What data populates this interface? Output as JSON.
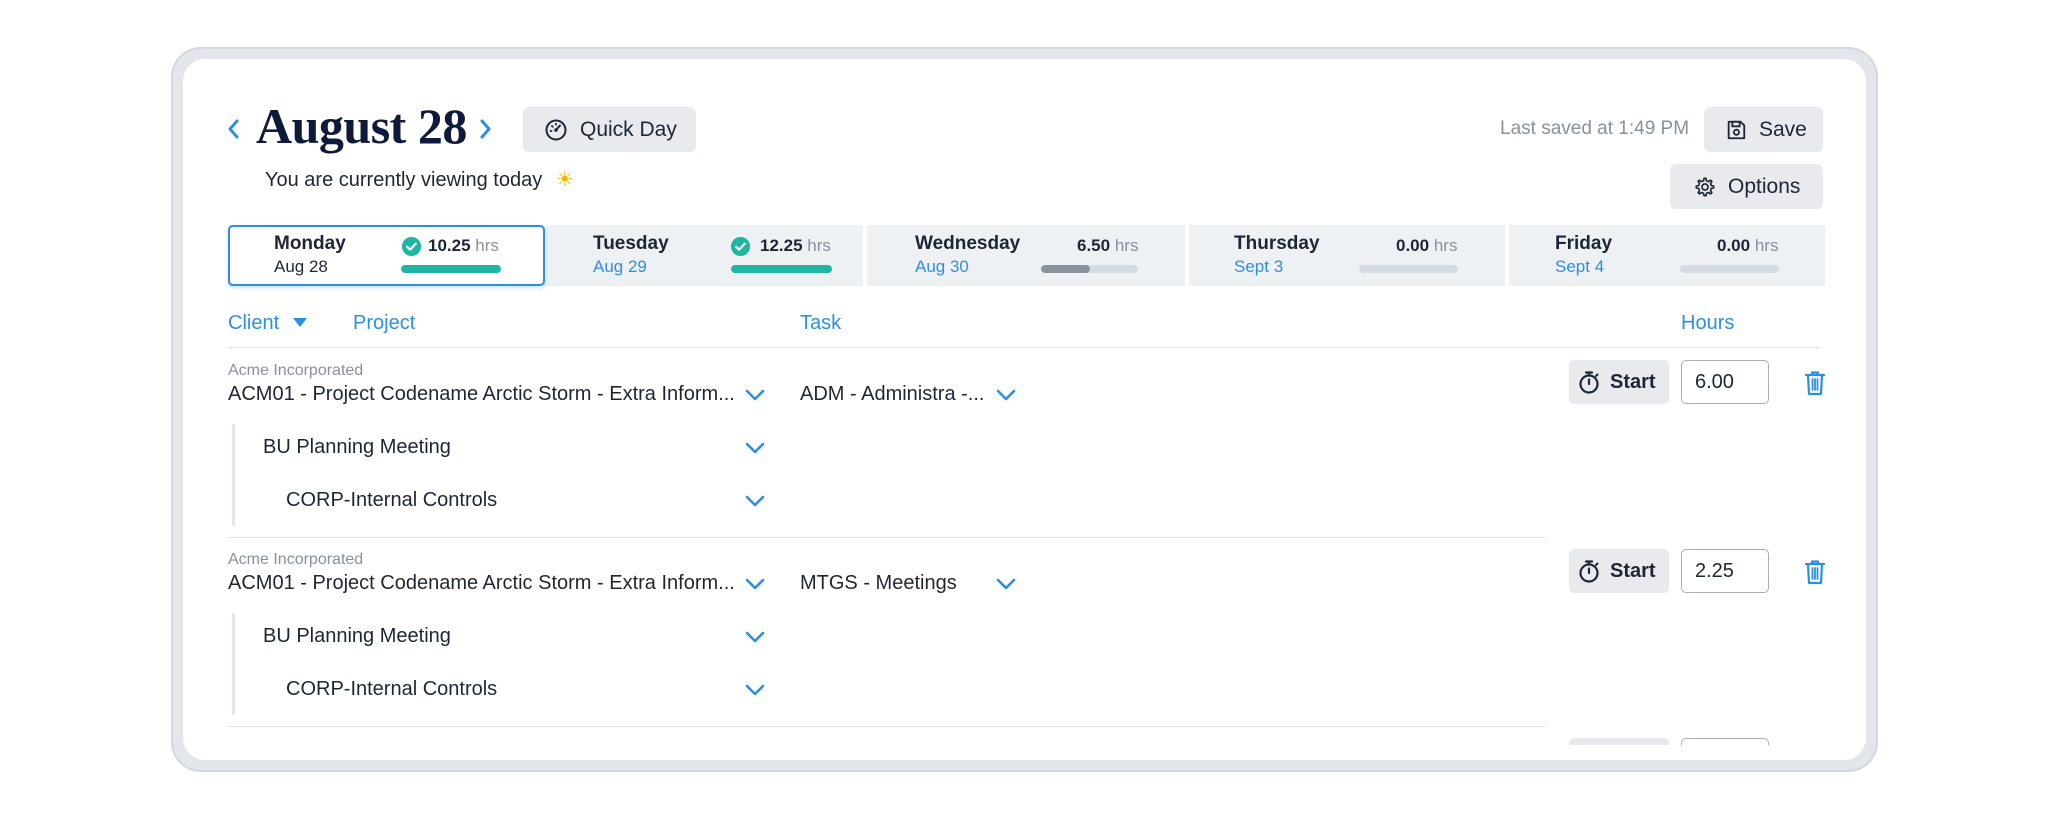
{
  "header": {
    "title": "August 28",
    "quick_day_label": "Quick Day",
    "viewing_text": "You are currently viewing today",
    "viewing_emoji": "☀",
    "last_saved": "Last saved at 1:49 PM",
    "save_label": "Save",
    "options_label": "Options"
  },
  "days": [
    {
      "name": "Monday",
      "date": "Aug 28",
      "hours": "10.25",
      "unit": "hrs",
      "complete": true,
      "progress": 1.0
    },
    {
      "name": "Tuesday",
      "date": "Aug 29",
      "hours": "12.25",
      "unit": "hrs",
      "complete": true,
      "progress": 1.0
    },
    {
      "name": "Wednesday",
      "date": "Aug 30",
      "hours": "6.50",
      "unit": "hrs",
      "complete": false,
      "progress": 0.5
    },
    {
      "name": "Thursday",
      "date": "Sept 3",
      "hours": "0.00",
      "unit": "hrs",
      "complete": false,
      "progress": 0.0
    },
    {
      "name": "Friday",
      "date": "Sept 4",
      "hours": "0.00",
      "unit": "hrs",
      "complete": false,
      "progress": 0.0
    }
  ],
  "columns": {
    "client": "Client",
    "project": "Project",
    "task": "Task",
    "hours": "Hours"
  },
  "entries": [
    {
      "client": "Acme Incorporated",
      "project": "ACM01 - Project Codename Arctic Storm - Extra Inform...",
      "task": "ADM - Administra -...",
      "sub1": "BU Planning Meeting",
      "sub2": "CORP-Internal Controls",
      "start_label": "Start",
      "hours": "6.00"
    },
    {
      "client": "Acme Incorporated",
      "project": "ACM01 - Project Codename Arctic Storm - Extra Inform...",
      "task": "MTGS - Meetings",
      "sub1": "BU Planning Meeting",
      "sub2": "CORP-Internal Controls",
      "start_label": "Start",
      "hours": "2.25"
    }
  ],
  "colors": {
    "accent_blue": "#2d8fe0",
    "complete_teal": "#1fb6a1",
    "partial_grey": "#8a939e",
    "title_navy": "#0f1a3a"
  }
}
